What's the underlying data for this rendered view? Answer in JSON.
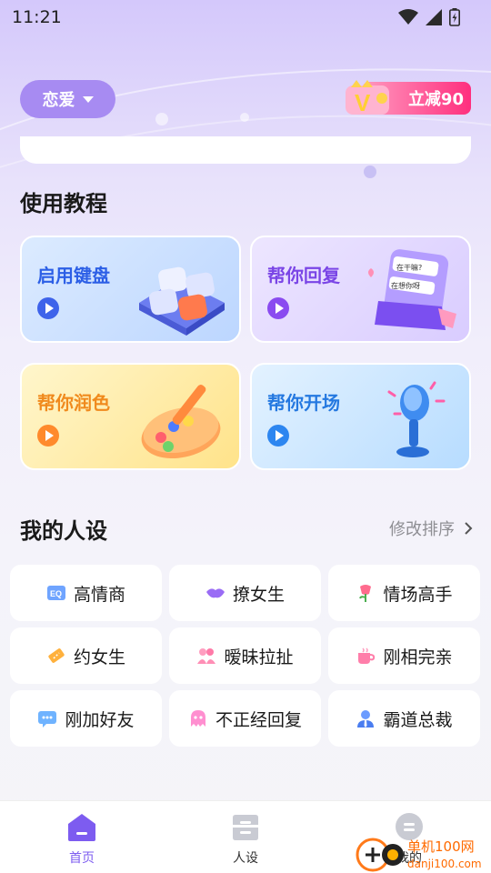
{
  "status_bar": {
    "time": "11:21"
  },
  "header": {
    "mode_label": "恋爱",
    "vip_badge_text": "立减90",
    "vip_letter": "V"
  },
  "tutorial": {
    "title": "使用教程",
    "cards": [
      {
        "label": "启用键盘"
      },
      {
        "label": "帮你回复",
        "bubble_line_1": "在干嘛?",
        "bubble_line_2": "在想你呀"
      },
      {
        "label": "帮你润色"
      },
      {
        "label": "帮你开场"
      }
    ]
  },
  "persona": {
    "title": "我的人设",
    "edit_sort_label": "修改排序",
    "items": [
      {
        "label": "高情商",
        "icon": "eq-icon",
        "badge": "EQ"
      },
      {
        "label": "撩女生",
        "icon": "lips-icon"
      },
      {
        "label": "情场高手",
        "icon": "rose-icon"
      },
      {
        "label": "约女生",
        "icon": "ticket-icon"
      },
      {
        "label": "暧昧拉扯",
        "icon": "couple-icon"
      },
      {
        "label": "刚相完亲",
        "icon": "cup-icon"
      },
      {
        "label": "刚加好友",
        "icon": "chat-icon"
      },
      {
        "label": "不正经回复",
        "icon": "ghost-icon"
      },
      {
        "label": "霸道总裁",
        "icon": "boss-icon"
      }
    ]
  },
  "tab_bar": {
    "tabs": [
      {
        "label": "首页",
        "active": true
      },
      {
        "label": "人设",
        "active": false
      },
      {
        "label": "我的",
        "active": false
      }
    ]
  },
  "watermark": {
    "line_1": "单机100网",
    "line_2": "danji100.com"
  },
  "colors": {
    "accent": "#7d5cf0",
    "pill": "#a78bf2",
    "vip": "#ff2f7e",
    "play_blue": "#4b6bf5",
    "play_orange": "#ff8a3d"
  }
}
